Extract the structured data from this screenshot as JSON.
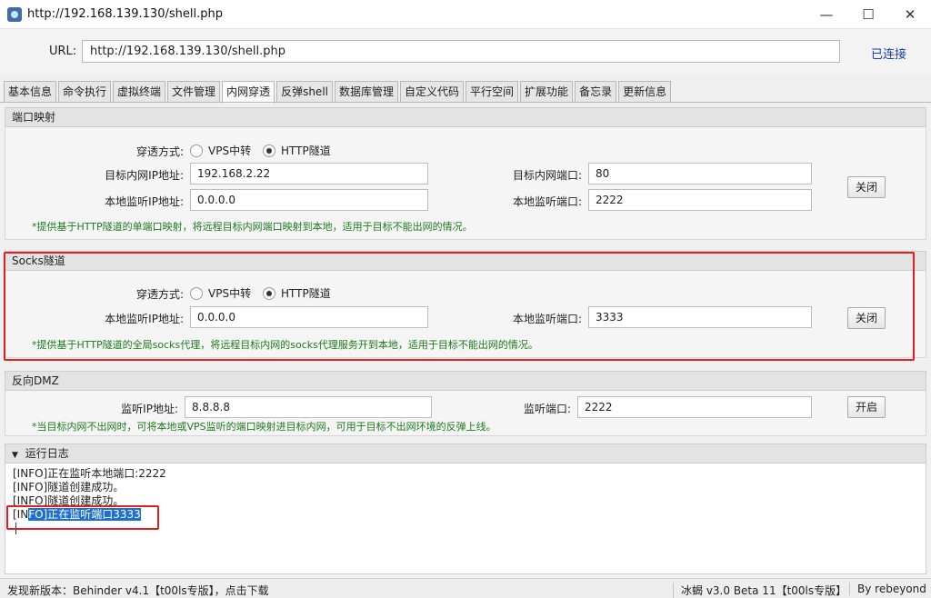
{
  "window": {
    "title": "http://192.168.139.130/shell.php",
    "minimize": "—",
    "maximize": "☐",
    "close": "✕"
  },
  "url_bar": {
    "label": "URL:",
    "value": "http://192.168.139.130/shell.php",
    "status": "已连接"
  },
  "tabs": [
    {
      "label": "基本信息"
    },
    {
      "label": "命令执行"
    },
    {
      "label": "虚拟终端"
    },
    {
      "label": "文件管理"
    },
    {
      "label": "内网穿透"
    },
    {
      "label": "反弹shell"
    },
    {
      "label": "数据库管理"
    },
    {
      "label": "自定义代码"
    },
    {
      "label": "平行空间"
    },
    {
      "label": "扩展功能"
    },
    {
      "label": "备忘录"
    },
    {
      "label": "更新信息"
    }
  ],
  "port_mapping": {
    "title": "端口映射",
    "mode_label": "穿透方式:",
    "mode_options": [
      "VPS中转",
      "HTTP隧道"
    ],
    "target_ip_label": "目标内网IP地址:",
    "target_ip": "192.168.2.22",
    "target_port_label": "目标内网端口:",
    "target_port": "80",
    "local_ip_label": "本地监听IP地址:",
    "local_ip": "0.0.0.0",
    "local_port_label": "本地监听端口:",
    "local_port": "2222",
    "button": "关闭",
    "note": "*提供基于HTTP隧道的单端口映射，将远程目标内网端口映射到本地，适用于目标不能出网的情况。"
  },
  "socks": {
    "title": "Socks隧道",
    "mode_label": "穿透方式:",
    "mode_options": [
      "VPS中转",
      "HTTP隧道"
    ],
    "local_ip_label": "本地监听IP地址:",
    "local_ip": "0.0.0.0",
    "local_port_label": "本地监听端口:",
    "local_port": "3333",
    "button": "关闭",
    "note": "*提供基于HTTP隧道的全局socks代理，将远程目标内网的socks代理服务开到本地，适用于目标不能出网的情况。"
  },
  "dmz": {
    "title": "反向DMZ",
    "ip_label": "监听IP地址:",
    "ip": "8.8.8.8",
    "port_label": "监听端口:",
    "port": "2222",
    "button": "开启",
    "note": "*当目标内网不出网时，可将本地或VPS监听的端口映射进目标内网，可用于目标不出网环境的反弹上线。"
  },
  "log": {
    "title": "运行日志",
    "lines": [
      "[INFO]正在监听本地端口:2222",
      "[INFO]隧道创建成功。",
      "[INFO]隧道创建成功。"
    ],
    "last_prefix": "[IN",
    "last_selected": "FO]正在监听端口3333"
  },
  "status": {
    "left": "发现新版本：Behinder v4.1【t00ls专版】，点击下载",
    "version": "冰蝎 v3.0 Beta 11【t00ls专版】",
    "author": "By rebeyond"
  },
  "colors": {
    "highlight": "#e02020",
    "note": "#1f7a1f",
    "selection": "#1f6fd0",
    "link": "#1a3fa8"
  }
}
